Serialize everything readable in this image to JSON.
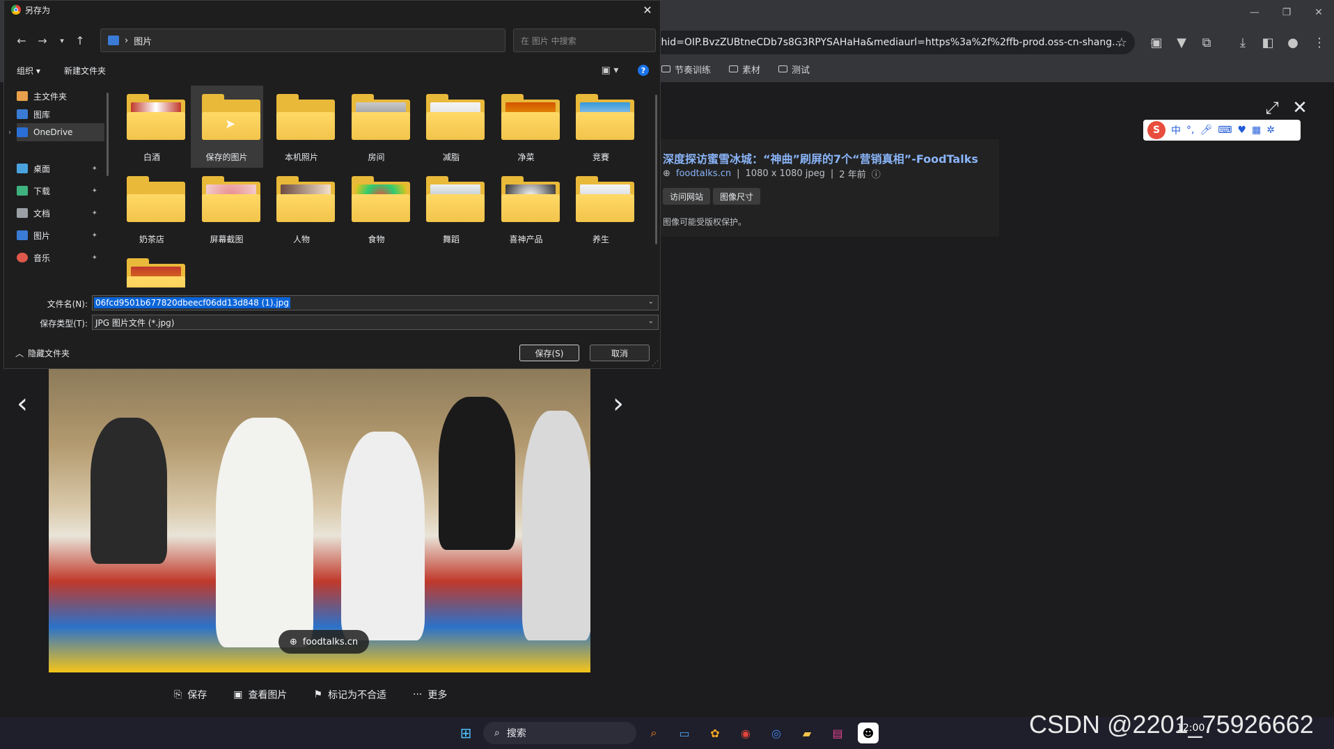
{
  "browser": {
    "url": "thid=OIP.BvzZUBtneCDb7s8G3RPYSAHaHa&mediaurl=https%3a%2f%2ffb-prod.oss-cn-shang...",
    "bookmarks": [
      "节奏训练",
      "素材",
      "测试"
    ]
  },
  "viewer": {
    "result_title": "深度探访蜜雪冰城：“神曲”刷屏的7个“营销真相”-FoodTalks",
    "source_domain": "foodtalks.cn",
    "dimensions": "1080 x 1080 jpeg",
    "age": "2 年前",
    "visit_label": "访问网站",
    "size_label": "图像尺寸",
    "copyright_note": "图像可能受版权保护。",
    "photo_source": "foodtalks.cn",
    "actions": [
      "保存",
      "查看图片",
      "标记为不合适",
      "更多"
    ]
  },
  "ime": {
    "logo": "S",
    "mode": "中"
  },
  "dialog": {
    "title": "另存为",
    "path": "图片",
    "search_placeholder": "在 图片 中搜索",
    "organize_label": "组织 ▾",
    "new_folder_label": "新建文件夹",
    "nav_items": [
      {
        "label": "主文件夹",
        "pinned": false
      },
      {
        "label": "图库",
        "pinned": false
      },
      {
        "label": "OneDrive",
        "pinned": false
      },
      {
        "label": "桌面",
        "pinned": true
      },
      {
        "label": "下载",
        "pinned": true
      },
      {
        "label": "文档",
        "pinned": true
      },
      {
        "label": "图片",
        "pinned": true
      },
      {
        "label": "音乐",
        "pinned": true
      }
    ],
    "folders": [
      {
        "label": "白酒"
      },
      {
        "label": "保存的图片"
      },
      {
        "label": "本机照片"
      },
      {
        "label": "房间"
      },
      {
        "label": "减脂"
      },
      {
        "label": "净菜"
      },
      {
        "label": "竞賽"
      },
      {
        "label": "奶茶店"
      },
      {
        "label": "屏幕截图"
      },
      {
        "label": "人物"
      },
      {
        "label": "食物"
      },
      {
        "label": "舞蹈"
      },
      {
        "label": "喜神产品"
      },
      {
        "label": "养生"
      }
    ],
    "filename_label": "文件名(N):",
    "filename_value": "06fcd9501b677820dbeecf06dd13d848 (1).jpg",
    "filetype_label": "保存类型(T):",
    "filetype_value": "JPG 图片文件 (*.jpg)",
    "hide_folders_label": "隐藏文件夹",
    "save_label": "保存(S)",
    "cancel_label": "取消"
  },
  "taskbar": {
    "search_label": "搜索",
    "time": "12:00"
  },
  "watermark": "CSDN @2201_75926662"
}
